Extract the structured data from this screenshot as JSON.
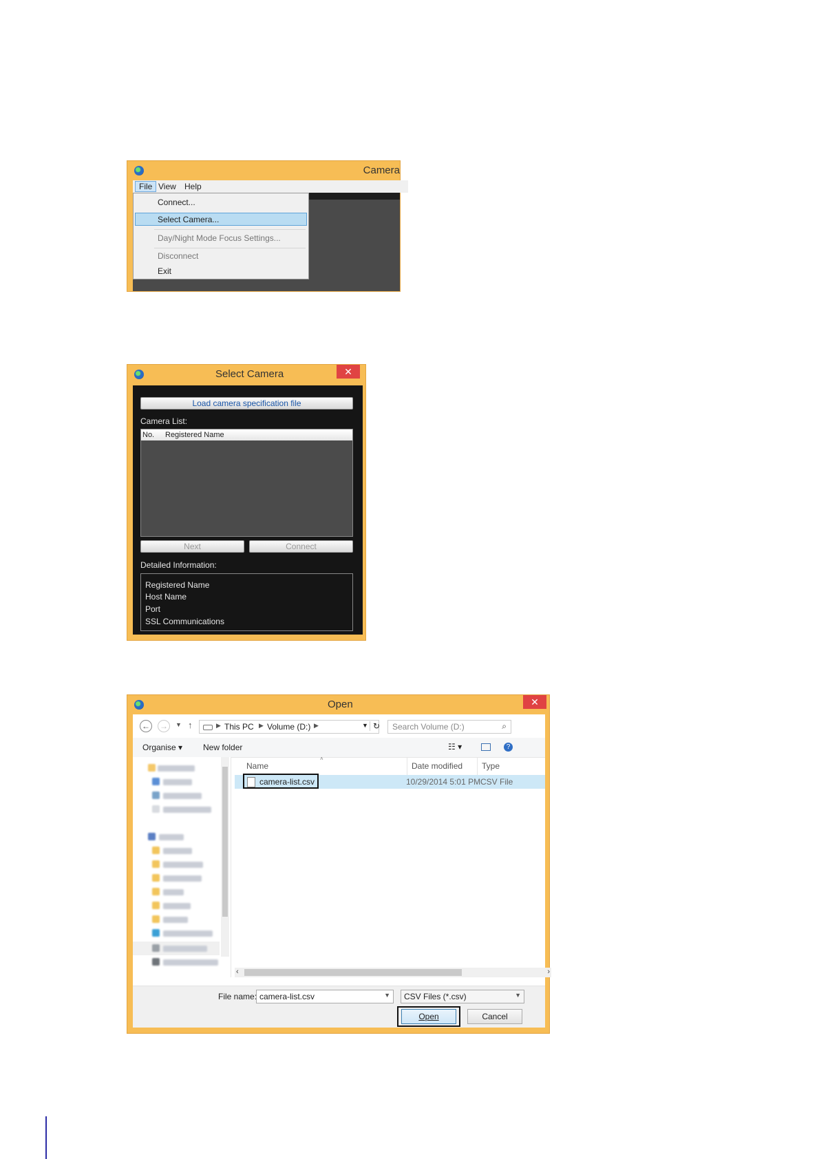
{
  "win1": {
    "title": "Camera",
    "menu": [
      "File",
      "View",
      "Help"
    ],
    "items": {
      "connect": "Connect...",
      "select_camera": "Select Camera...",
      "day_night": "Day/Night Mode Focus Settings...",
      "disconnect": "Disconnect",
      "exit": "Exit"
    }
  },
  "win2": {
    "title": "Select Camera",
    "close": "✕",
    "load_button": "Load camera specification file",
    "camera_list_label": "Camera List:",
    "columns": [
      "No.",
      "Registered Name"
    ],
    "next_button": "Next",
    "connect_button": "Connect",
    "detail_label": "Detailed Information:",
    "details": [
      "Registered Name",
      "Host Name",
      "Port",
      "SSL Communications"
    ]
  },
  "win3": {
    "title": "Open",
    "close": "✕",
    "breadcrumb": [
      "This PC",
      "Volume (D:)"
    ],
    "search_placeholder": "Search Volume (D:)",
    "organise": "Organise",
    "new_folder": "New folder",
    "columns": {
      "name": "Name",
      "date": "Date modified",
      "type": "Type"
    },
    "file": {
      "name": "camera-list.csv",
      "date": "10/29/2014 5:01 PM",
      "type": "CSV File"
    },
    "file_name_label": "File name:",
    "file_name_value": "camera-list.csv",
    "file_type": "CSV Files (*.csv)",
    "open_button": "Open",
    "cancel_button": "Cancel"
  },
  "icons": [
    "back-arrow-icon",
    "forward-arrow-icon",
    "up-arrow-icon",
    "refresh-icon",
    "search-icon",
    "view-icon",
    "help-icon",
    "drive-icon",
    "file-icon"
  ]
}
